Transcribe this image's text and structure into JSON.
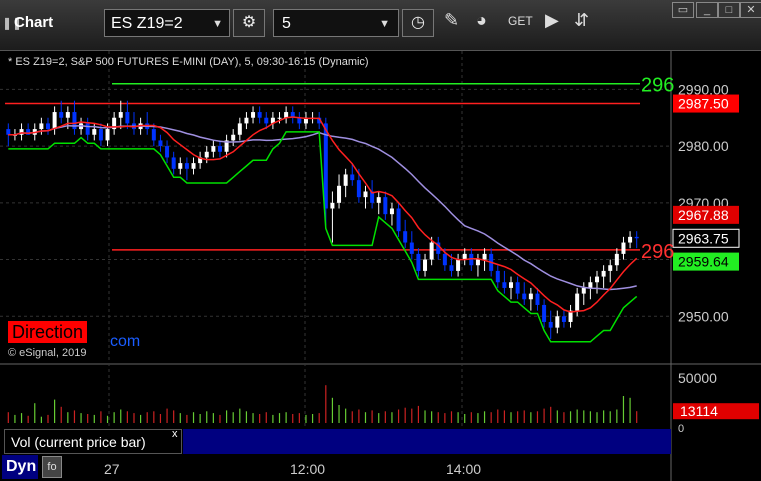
{
  "toolbar": {
    "pause_icon": "pause-icon",
    "title": "Chart",
    "symbol": "ES Z19=2",
    "interval": "5",
    "icons": [
      "settings-gear-icon",
      "clock-icon",
      "pencil-draw-icon",
      "study-indicator-icon",
      "get-data-icon",
      "play-icon",
      "scroll-icon"
    ],
    "window_buttons": [
      "restore-icon",
      "minimize-icon",
      "maximize-icon",
      "close-icon"
    ]
  },
  "chart": {
    "header": "* ES Z19=2, S&P 500 FUTURES E-MINI (DAY), 5, 09:30-16:15 (Dynamic)",
    "direction_label": "Direction",
    "direction_suffix": "com",
    "copyright": "© eSignal, 2019",
    "vol_legend": "Vol (current price bar)",
    "vol_close": "x",
    "dyn_label": "Dyn",
    "time_labels": [
      "27",
      "12:00",
      "14:00"
    ],
    "price_ticks": [
      "2990.00",
      "2980.00",
      "2970.00",
      "2950.00"
    ],
    "volume_tick": "50000",
    "volume_tick_zero": "0",
    "price_flags": [
      {
        "label": "2987.50",
        "color": "#ff0000",
        "text_color": "#ffffff"
      },
      {
        "label": "2967.88",
        "color": "#e00000",
        "text_color": "#ffffff"
      },
      {
        "label": "2963.75",
        "color": "#000000",
        "text_color": "#ffffff"
      },
      {
        "label": "2959.64",
        "color": "#22ee22",
        "text_color": "#000000"
      }
    ],
    "volume_flag": {
      "label": "13114",
      "color": "#e00000",
      "text_color": "#ffffff"
    },
    "line_labels": [
      {
        "label": "296",
        "color": "#22ee22"
      },
      {
        "label": "296",
        "color": "#ff3030"
      }
    ],
    "colors": {
      "up": "#ffffff",
      "down": "#0033ff",
      "green_line": "#00e000",
      "red_line": "#ff2020",
      "purple_line": "#9f8fe0",
      "vol_up": "#66cc33",
      "vol_down": "#cc2222"
    }
  },
  "chart_data": {
    "type": "candlestick",
    "yrange": [
      2943,
      2995
    ],
    "ylim_note": "price axis",
    "horizontal_levels": [
      {
        "value": 2991.0,
        "color": "green"
      },
      {
        "value": 2987.5,
        "color": "red"
      },
      {
        "value": 2961.7,
        "color": "red"
      }
    ],
    "candles": [
      [
        2983,
        2984,
        2980,
        2982
      ],
      [
        2982,
        2983,
        2981,
        2982
      ],
      [
        2982,
        2984,
        2981,
        2983
      ],
      [
        2983,
        2984,
        2982,
        2982
      ],
      [
        2982,
        2984,
        2981,
        2983
      ],
      [
        2983,
        2985,
        2982,
        2984
      ],
      [
        2984,
        2985,
        2982,
        2983
      ],
      [
        2983,
        2987,
        2982,
        2986
      ],
      [
        2986,
        2988,
        2984,
        2985
      ],
      [
        2985,
        2987,
        2983,
        2986
      ],
      [
        2986,
        2988,
        2982,
        2983
      ],
      [
        2983,
        2985,
        2982,
        2984
      ],
      [
        2984,
        2985,
        2981,
        2982
      ],
      [
        2982,
        2984,
        2981,
        2983
      ],
      [
        2983,
        2984,
        2980,
        2981
      ],
      [
        2981,
        2984,
        2980,
        2983
      ],
      [
        2983,
        2986,
        2982,
        2985
      ],
      [
        2985,
        2988,
        2983,
        2986
      ],
      [
        2986,
        2988,
        2983,
        2984
      ],
      [
        2984,
        2986,
        2982,
        2983
      ],
      [
        2983,
        2985,
        2982,
        2984
      ],
      [
        2984,
        2986,
        2982,
        2983
      ],
      [
        2983,
        2984,
        2980,
        2981
      ],
      [
        2981,
        2982,
        2979,
        2980
      ],
      [
        2980,
        2981,
        2977,
        2978
      ],
      [
        2978,
        2979,
        2975,
        2976
      ],
      [
        2976,
        2978,
        2975,
        2977
      ],
      [
        2977,
        2978,
        2974,
        2976
      ],
      [
        2976,
        2978,
        2975,
        2977
      ],
      [
        2977,
        2979,
        2976,
        2978
      ],
      [
        2978,
        2980,
        2977,
        2979
      ],
      [
        2979,
        2981,
        2978,
        2980
      ],
      [
        2980,
        2981,
        2978,
        2979
      ],
      [
        2979,
        2982,
        2978,
        2981
      ],
      [
        2981,
        2983,
        2980,
        2982
      ],
      [
        2982,
        2985,
        2981,
        2984
      ],
      [
        2984,
        2986,
        2983,
        2985
      ],
      [
        2985,
        2987,
        2984,
        2986
      ],
      [
        2986,
        2987,
        2984,
        2985
      ],
      [
        2985,
        2986,
        2983,
        2984
      ],
      [
        2984,
        2986,
        2983,
        2985
      ],
      [
        2985,
        2986,
        2984,
        2985
      ],
      [
        2985,
        2987,
        2984,
        2986
      ],
      [
        2986,
        2987,
        2984,
        2985
      ],
      [
        2985,
        2986,
        2983,
        2984
      ],
      [
        2984,
        2986,
        2983,
        2985
      ],
      [
        2985,
        2986,
        2984,
        2985
      ],
      [
        2985,
        2986,
        2983,
        2984
      ],
      [
        2984,
        2985,
        2966,
        2969
      ],
      [
        2969,
        2972,
        2963,
        2970
      ],
      [
        2970,
        2975,
        2969,
        2973
      ],
      [
        2973,
        2976,
        2971,
        2975
      ],
      [
        2975,
        2977,
        2973,
        2974
      ],
      [
        2974,
        2976,
        2970,
        2971
      ],
      [
        2971,
        2973,
        2969,
        2972
      ],
      [
        2972,
        2974,
        2969,
        2970
      ],
      [
        2970,
        2972,
        2968,
        2971
      ],
      [
        2971,
        2972,
        2967,
        2968
      ],
      [
        2968,
        2970,
        2966,
        2969
      ],
      [
        2969,
        2970,
        2964,
        2965
      ],
      [
        2965,
        2967,
        2962,
        2963
      ],
      [
        2963,
        2965,
        2960,
        2961
      ],
      [
        2961,
        2962,
        2957,
        2958
      ],
      [
        2958,
        2961,
        2957,
        2960
      ],
      [
        2960,
        2964,
        2959,
        2963
      ],
      [
        2963,
        2964,
        2960,
        2961
      ],
      [
        2961,
        2962,
        2958,
        2959
      ],
      [
        2959,
        2961,
        2957,
        2958
      ],
      [
        2958,
        2961,
        2957,
        2960
      ],
      [
        2960,
        2962,
        2959,
        2961
      ],
      [
        2961,
        2962,
        2958,
        2959
      ],
      [
        2959,
        2961,
        2957,
        2960
      ],
      [
        2960,
        2962,
        2958,
        2961
      ],
      [
        2961,
        2962,
        2957,
        2958
      ],
      [
        2958,
        2959,
        2955,
        2956
      ],
      [
        2956,
        2958,
        2954,
        2955
      ],
      [
        2955,
        2957,
        2953,
        2956
      ],
      [
        2956,
        2957,
        2953,
        2954
      ],
      [
        2954,
        2956,
        2952,
        2953
      ],
      [
        2953,
        2955,
        2951,
        2954
      ],
      [
        2954,
        2955,
        2951,
        2952
      ],
      [
        2952,
        2953,
        2948,
        2949
      ],
      [
        2949,
        2951,
        2946,
        2948
      ],
      [
        2948,
        2951,
        2947,
        2950
      ],
      [
        2950,
        2951,
        2948,
        2949
      ],
      [
        2949,
        2952,
        2948,
        2951
      ],
      [
        2951,
        2955,
        2950,
        2954
      ],
      [
        2954,
        2956,
        2952,
        2955
      ],
      [
        2955,
        2957,
        2953,
        2956
      ],
      [
        2956,
        2958,
        2954,
        2957
      ],
      [
        2957,
        2959,
        2955,
        2958
      ],
      [
        2958,
        2960,
        2956,
        2959
      ],
      [
        2959,
        2962,
        2958,
        2961
      ],
      [
        2961,
        2964,
        2960,
        2963
      ],
      [
        2963,
        2965,
        2962,
        2964
      ],
      [
        2964,
        2965,
        2962,
        2963.75
      ]
    ],
    "volume_range": [
      0,
      60000
    ],
    "volume": [
      12000,
      9000,
      11000,
      8000,
      22000,
      7000,
      9000,
      26000,
      18000,
      12000,
      14000,
      11000,
      10000,
      9000,
      13000,
      8000,
      12000,
      15000,
      13000,
      11000,
      9000,
      12000,
      13000,
      10000,
      16000,
      14000,
      11000,
      9000,
      12000,
      10000,
      13000,
      11000,
      9000,
      14000,
      12000,
      16000,
      13000,
      11000,
      10000,
      12000,
      9000,
      11000,
      12000,
      10000,
      11000,
      9000,
      10000,
      11000,
      42000,
      28000,
      20000,
      16000,
      13000,
      15000,
      12000,
      14000,
      11000,
      13000,
      12000,
      15000,
      17000,
      16000,
      19000,
      14000,
      13000,
      12000,
      11000,
      13000,
      12000,
      10000,
      12000,
      11000,
      13000,
      12000,
      15000,
      14000,
      12000,
      13000,
      14000,
      12000,
      13000,
      16000,
      18000,
      14000,
      12000,
      13000,
      15000,
      14000,
      13000,
      12000,
      14000,
      13000,
      15000,
      30000,
      28000,
      13114
    ]
  }
}
